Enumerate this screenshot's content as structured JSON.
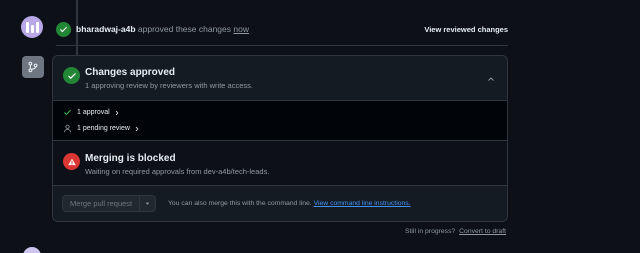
{
  "approval_event": {
    "username": "bharadwaj-a4b",
    "action_text": "approved these changes",
    "when": "now",
    "view_reviewed_label": "View reviewed changes"
  },
  "merge_box": {
    "approved": {
      "title": "Changes approved",
      "subtitle": "1 approving review by reviewers with write access."
    },
    "reviews": [
      {
        "label": "1 approval",
        "icon": "check-icon"
      },
      {
        "label": "1 pending review",
        "icon": "person-icon"
      }
    ],
    "blocked": {
      "title": "Merging is blocked",
      "subtitle": "Waiting on required approvals from dev-a4b/tech-leads."
    },
    "actions": {
      "merge_button_label": "Merge pull request",
      "cli_prefix": "You can also merge this with the command line.",
      "cli_link": "View command line instructions."
    }
  },
  "footer": {
    "still_in_progress": "Still in progress?",
    "convert_to_draft": "Convert to draft"
  },
  "colors": {
    "background": "#0d1117",
    "success": "#238636",
    "danger": "#da3633",
    "link": "#4493f8",
    "muted": "#9198a1"
  }
}
